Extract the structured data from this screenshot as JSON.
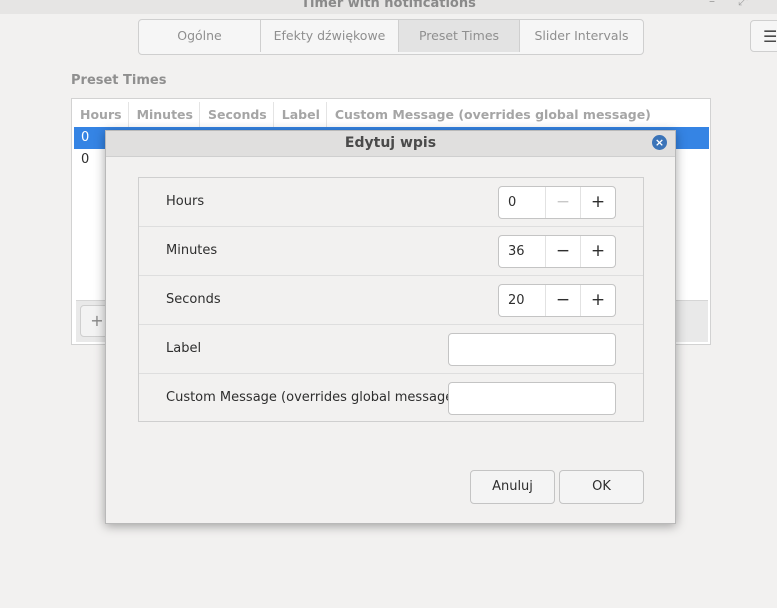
{
  "app": {
    "title": "Timer with notifications",
    "minimize_symbol": "–",
    "maximize_symbol": "⤢"
  },
  "menu": {
    "icon": "hamburger-menu-icon",
    "symbol": "☰"
  },
  "tabs": [
    {
      "label": "Ogólne",
      "active": false
    },
    {
      "label": "Efekty dźwiękowe",
      "active": false
    },
    {
      "label": "Preset Times",
      "active": true
    },
    {
      "label": "Slider Intervals",
      "active": false
    }
  ],
  "preset_section": {
    "title": "Preset Times",
    "columns": [
      "Hours",
      "Minutes",
      "Seconds",
      "Label",
      "Custom Message (overrides global message)"
    ],
    "rows": [
      {
        "hours": "0",
        "selected": true
      },
      {
        "hours": "0",
        "selected": false
      }
    ],
    "add_symbol": "+"
  },
  "dialog": {
    "title": "Edytuj wpis",
    "close_symbol": "×",
    "fields": {
      "hours": {
        "label": "Hours",
        "value": "0",
        "decrement_disabled": true
      },
      "minutes": {
        "label": "Minutes",
        "value": "36",
        "decrement_disabled": false
      },
      "seconds": {
        "label": "Seconds",
        "value": "20",
        "decrement_disabled": false
      },
      "label": {
        "label": "Label",
        "value": ""
      },
      "custom_message": {
        "label": "Custom Message (overrides global message)",
        "value": ""
      }
    },
    "minus_symbol": "−",
    "plus_symbol": "+",
    "cancel_label": "Anuluj",
    "ok_label": "OK"
  },
  "colors": {
    "selection": "#3584e4",
    "close_button": "#3b74b8"
  }
}
